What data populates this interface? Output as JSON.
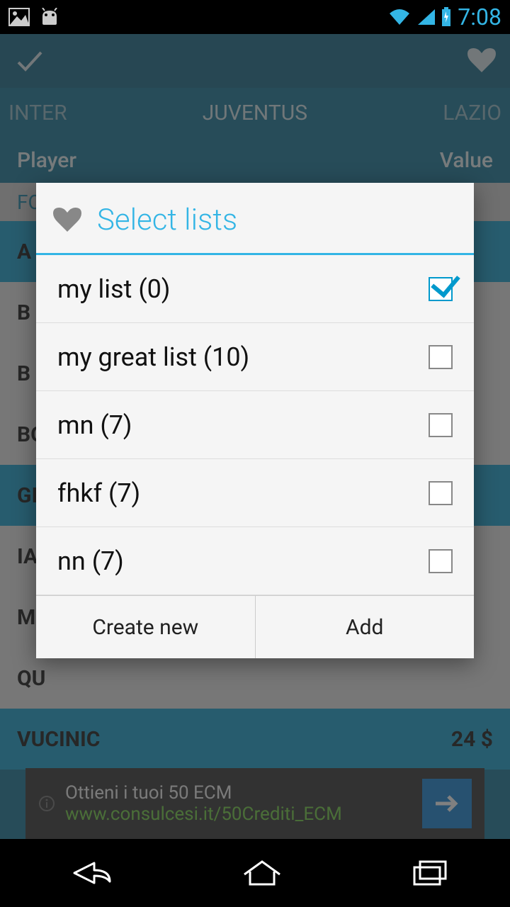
{
  "status": {
    "time": "7:08"
  },
  "tabs": {
    "left": "INTER",
    "center": "JUVENTUS",
    "right": "LAZIO"
  },
  "headers": {
    "player": "Player",
    "value": "Value"
  },
  "rows": {
    "section": "FO",
    "r0": "A",
    "r1": "B",
    "r2": "B",
    "r3": "BO",
    "r4": "GI",
    "r5": "IA",
    "r6": "M",
    "r7": "QU",
    "r8_name": "VUCINIC",
    "r8_value": "24 $"
  },
  "ad": {
    "title": "Ottieni i tuoi 50 ECM",
    "url": "www.consulcesi.it/50Crediti_ECM"
  },
  "dialog": {
    "title": "Select lists",
    "items": [
      {
        "label": "my list (0)",
        "checked": true
      },
      {
        "label": "my great list (10)",
        "checked": false
      },
      {
        "label": "mn (7)",
        "checked": false
      },
      {
        "label": "fhkf (7)",
        "checked": false
      },
      {
        "label": "nn (7)",
        "checked": false
      }
    ],
    "btn_create": "Create new",
    "btn_add": "Add"
  }
}
